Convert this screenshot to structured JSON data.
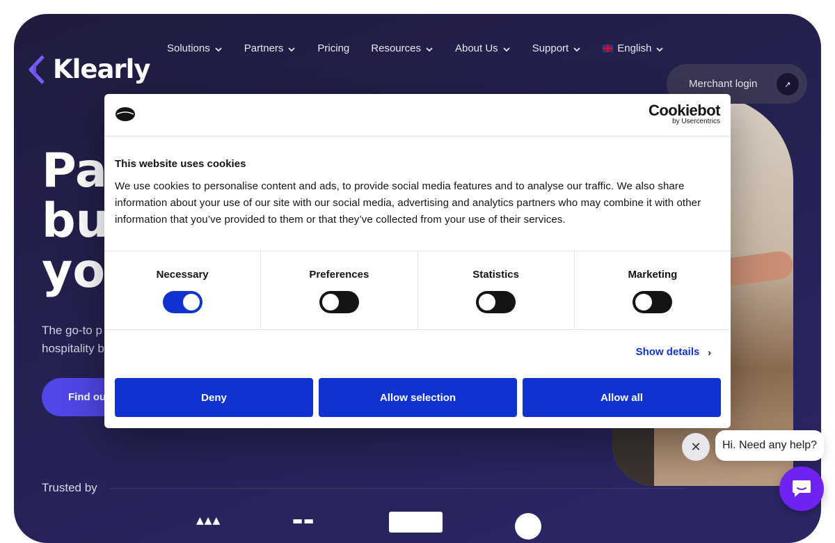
{
  "header": {
    "logo_text": "Klearly",
    "nav": [
      {
        "label": "Solutions",
        "dropdown": true
      },
      {
        "label": "Partners",
        "dropdown": true
      },
      {
        "label": "Pricing",
        "dropdown": false
      },
      {
        "label": "Resources",
        "dropdown": true
      },
      {
        "label": "About Us",
        "dropdown": true
      },
      {
        "label": "Support",
        "dropdown": true
      }
    ],
    "language": "English",
    "merchant_login": "Merchant login"
  },
  "hero": {
    "headline_lines": [
      "Pay",
      "bu",
      "yo"
    ],
    "subtext_lines": [
      "The go-to p",
      "hospitality b"
    ],
    "cta": "Find ou",
    "trusted_by": "Trusted by"
  },
  "cookie": {
    "brand_name": "Cookiebot",
    "brand_sub": "by Usercentrics",
    "title": "This website uses cookies",
    "text": "We use cookies to personalise content and ads, to provide social media features and to analyse our traffic. We also share information about your use of our site with our social media, advertising and analytics partners who may combine it with other information that you’ve provided to them or that they’ve collected from your use of their services.",
    "toggles": [
      {
        "label": "Necessary",
        "on": true
      },
      {
        "label": "Preferences",
        "on": false
      },
      {
        "label": "Statistics",
        "on": false
      },
      {
        "label": "Marketing",
        "on": false
      }
    ],
    "show_details": "Show details",
    "buttons": {
      "deny": "Deny",
      "allow_selection": "Allow selection",
      "allow_all": "Allow all"
    }
  },
  "chat": {
    "message": "Hi. Need any help?"
  },
  "colors": {
    "hero_bg": "#231f4a",
    "cta": "#4f47e8",
    "cookie_accent": "#1032cf",
    "chat": "#6f22f2"
  }
}
